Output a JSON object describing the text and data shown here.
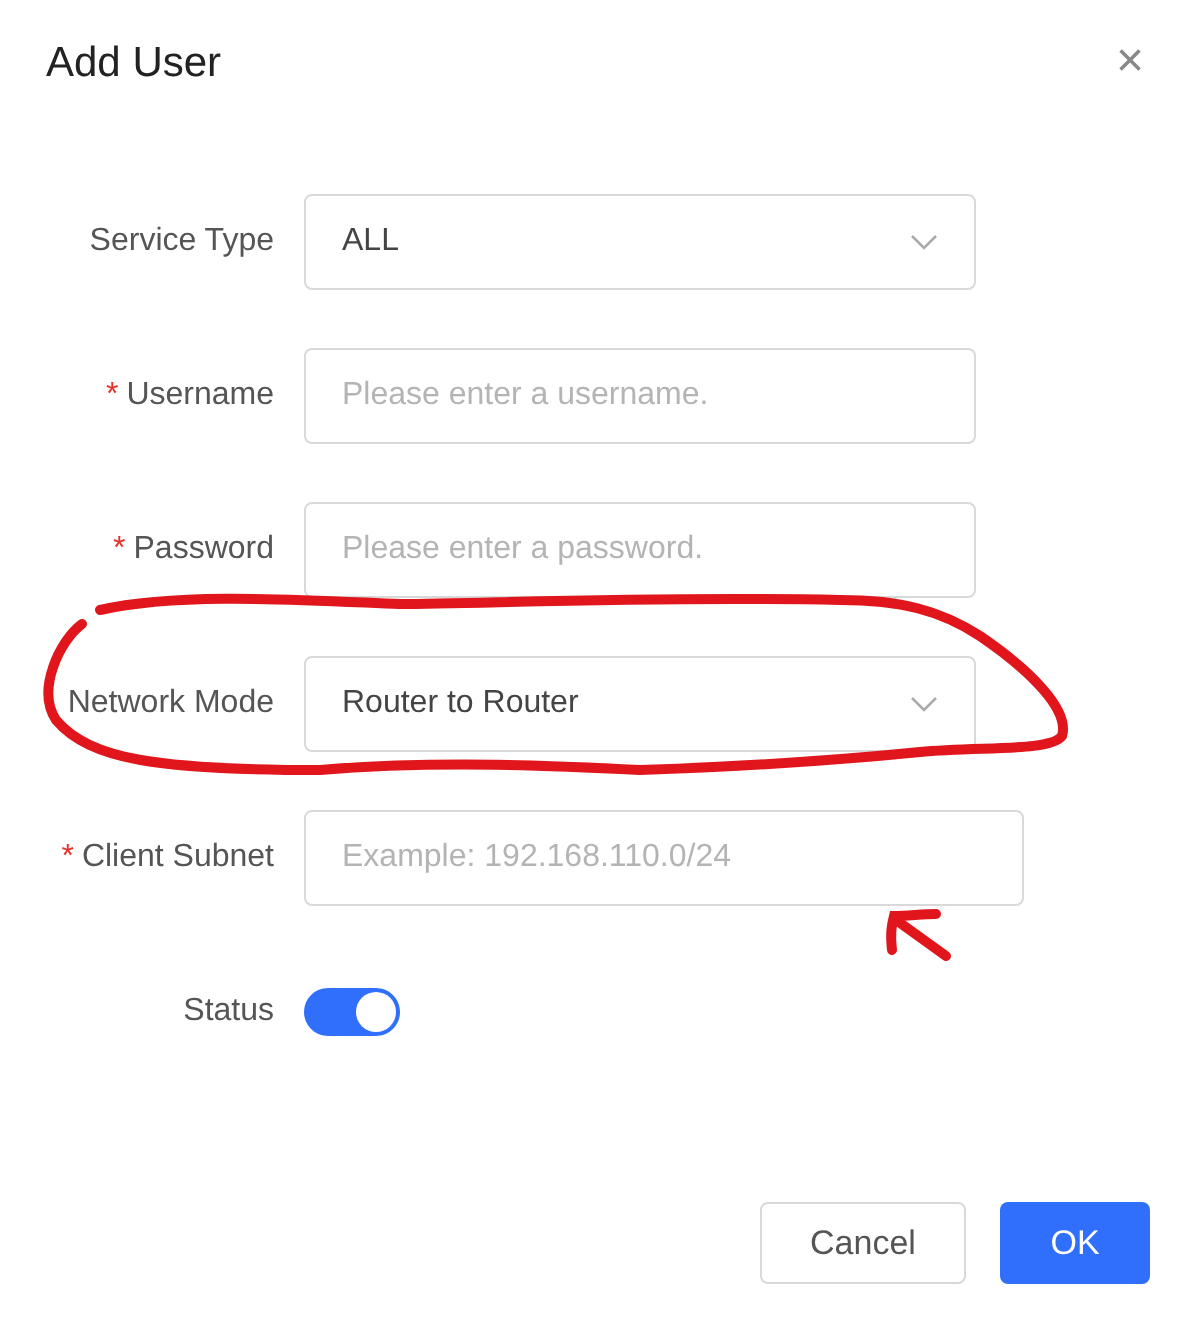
{
  "dialog": {
    "title": "Add User",
    "close": "×"
  },
  "fields": [
    {
      "kind": "select",
      "label": "Service Type",
      "value": "ALL"
    },
    {
      "kind": "input",
      "required_mark": "*",
      "label": "Username",
      "placeholder": "Please enter a username."
    },
    {
      "kind": "input",
      "required_mark": "*",
      "label": "Password",
      "placeholder": "Please enter a password."
    },
    {
      "kind": "select",
      "label": "Network Mode",
      "value": "Router to Router"
    },
    {
      "kind": "input",
      "required_mark": "*",
      "label": "Client Subnet",
      "placeholder": "Example: 192.168.110.0/24"
    },
    {
      "kind": "switch",
      "label": "Status",
      "on": true
    }
  ],
  "buttons": [
    {
      "label": "Cancel",
      "primary": false
    },
    {
      "label": "OK",
      "primary": true
    }
  ]
}
